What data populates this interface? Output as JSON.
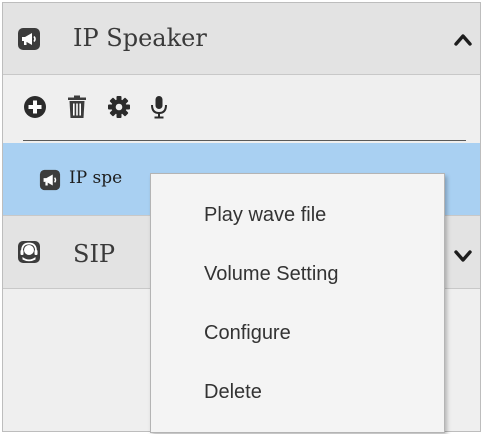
{
  "header": {
    "title": "IP Speaker",
    "icon": "megaphone-icon",
    "chevron": "chevron-up-icon"
  },
  "toolbar": {
    "buttons": [
      "add-icon",
      "trash-icon",
      "gear-icon",
      "microphone-icon"
    ]
  },
  "device_list": [
    {
      "label": "IP spe",
      "icon": "megaphone-icon",
      "selected": true
    }
  ],
  "sip": {
    "title": "SIP",
    "icon": "headset-icon",
    "chevron": "chevron-down-icon"
  },
  "context_menu": {
    "items": [
      {
        "label": "Play wave file"
      },
      {
        "label": "Volume Setting"
      },
      {
        "label": "Configure"
      },
      {
        "label": "Delete"
      }
    ]
  },
  "colors": {
    "selected_row": "#a9d0f2",
    "header_bg": "#e3e3e3",
    "panel_bg": "#efefef",
    "icon": "#3c3c3c"
  }
}
